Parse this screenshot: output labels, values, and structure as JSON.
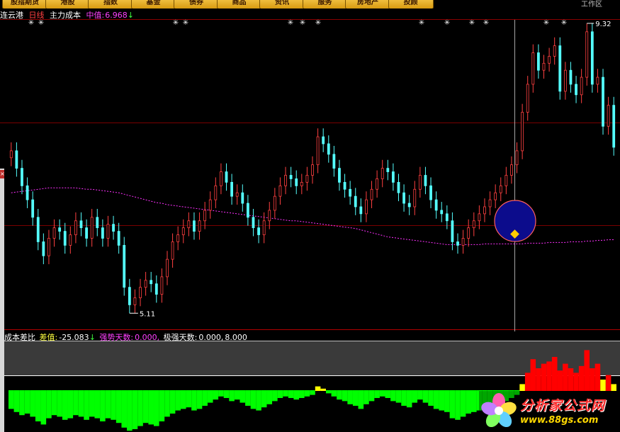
{
  "tabs": [
    "股指期货",
    "港股",
    "指数",
    "基金",
    "债券",
    "商品",
    "资讯",
    "服务",
    "房地产",
    "投顾"
  ],
  "workspace_label": "工作区",
  "main_chart": {
    "stock_name": "连云港",
    "period": "日线",
    "indicator_name": "主力成本",
    "mid_label": "中值:",
    "mid_value": "6.968",
    "mid_arrow": "↓",
    "high_label": "9.32",
    "low_label": "5.11"
  },
  "sub_chart": {
    "name": "成本差比",
    "diff_label": "差值:",
    "diff_value": "-25.083",
    "diff_arrow": "↓",
    "strong_label": "强势天数:",
    "strong_value": "0.000,",
    "very_strong_label": "极强天数:",
    "very_strong_value": "0.000,",
    "extra_value": "8.000"
  },
  "logo": {
    "name": "分析家公式网",
    "url": "www.88gs.com"
  },
  "colors": {
    "up": "#ff4040",
    "down": "#54ffff",
    "cost_line": "#ff30ff",
    "green_bar": "#00ff00",
    "yellow_bar": "#ffff00",
    "red_bar": "#ff0000",
    "header_white": "#ffffff",
    "header_red": "#ff4040",
    "header_magenta": "#ff40ff",
    "header_yellow": "#ffff40",
    "header_cyan": "#40ffff"
  },
  "chart_data": {
    "type": "candlestick",
    "price_range": [
      5.0,
      9.4
    ],
    "close": [
      7.55,
      7.3,
      7.05,
      6.85,
      6.6,
      6.25,
      6.05,
      6.3,
      6.45,
      6.4,
      6.2,
      6.35,
      6.55,
      6.45,
      6.3,
      6.6,
      6.45,
      6.3,
      6.5,
      6.4,
      6.2,
      5.6,
      5.35,
      5.45,
      5.6,
      5.7,
      5.65,
      5.5,
      5.75,
      6.0,
      6.25,
      6.35,
      6.45,
      6.55,
      6.4,
      6.55,
      6.7,
      6.85,
      7.05,
      7.25,
      7.1,
      6.9,
      6.95,
      6.8,
      6.6,
      6.45,
      6.35,
      6.55,
      6.7,
      6.9,
      7.05,
      7.2,
      7.15,
      7.05,
      7.1,
      7.2,
      7.35,
      7.75,
      7.65,
      7.5,
      7.3,
      7.1,
      7.0,
      6.9,
      6.75,
      6.65,
      6.85,
      7.0,
      7.15,
      7.3,
      7.25,
      7.1,
      6.95,
      6.8,
      6.75,
      7.0,
      7.2,
      7.05,
      6.85,
      6.7,
      6.65,
      6.55,
      6.25,
      6.2,
      6.3,
      6.45,
      6.55,
      6.65,
      6.75,
      6.85,
      6.95,
      7.05,
      7.2,
      7.35,
      7.55,
      8.1,
      8.5,
      8.95,
      8.7,
      8.8,
      8.9,
      9.05,
      8.4,
      8.7,
      8.5,
      8.35,
      8.6,
      9.25,
      8.5,
      8.6,
      7.9,
      8.2,
      7.6
    ],
    "cost_line": [
      6.95,
      6.96,
      6.97,
      6.98,
      6.99,
      7.0,
      7.01,
      7.02,
      7.02,
      7.02,
      7.02,
      7.02,
      7.02,
      7.01,
      7.0,
      7.0,
      6.99,
      6.98,
      6.97,
      6.96,
      6.95,
      6.93,
      6.91,
      6.89,
      6.87,
      6.85,
      6.83,
      6.81,
      6.8,
      6.78,
      6.77,
      6.76,
      6.75,
      6.74,
      6.73,
      6.72,
      6.71,
      6.7,
      6.69,
      6.68,
      6.67,
      6.66,
      6.65,
      6.64,
      6.63,
      6.62,
      6.61,
      6.6,
      6.59,
      6.58,
      6.57,
      6.56,
      6.55,
      6.55,
      6.54,
      6.53,
      6.52,
      6.51,
      6.5,
      6.49,
      6.48,
      6.47,
      6.46,
      6.45,
      6.44,
      6.42,
      6.4,
      6.38,
      6.36,
      6.34,
      6.32,
      6.31,
      6.3,
      6.29,
      6.28,
      6.27,
      6.26,
      6.25,
      6.24,
      6.23,
      6.22,
      6.21,
      6.21,
      6.21,
      6.21,
      6.21,
      6.21,
      6.21,
      6.22,
      6.22,
      6.22,
      6.22,
      6.22,
      6.22,
      6.22,
      6.22,
      6.23,
      6.23,
      6.23,
      6.23,
      6.24,
      6.24,
      6.24,
      6.24,
      6.25,
      6.25,
      6.25,
      6.26,
      6.26,
      6.27,
      6.27,
      6.28,
      6.28
    ],
    "sub_values": [
      -12,
      -14,
      -16,
      -15,
      -17,
      -20,
      -22,
      -18,
      -16,
      -17,
      -19,
      -18,
      -16,
      -17,
      -19,
      -17,
      -18,
      -20,
      -18,
      -19,
      -21,
      -24,
      -26,
      -25,
      -23,
      -21,
      -22,
      -23,
      -20,
      -17,
      -15,
      -13,
      -12,
      -11,
      -13,
      -12,
      -10,
      -8,
      -6,
      -4,
      -5,
      -7,
      -6,
      -8,
      -10,
      -12,
      -13,
      -11,
      -9,
      -7,
      -5,
      -4,
      -5,
      -6,
      -5,
      -4,
      -3,
      2,
      1,
      -2,
      -4,
      -6,
      -7,
      -9,
      -10,
      -12,
      -9,
      -7,
      -5,
      -4,
      -5,
      -7,
      -8,
      -10,
      -11,
      -8,
      -6,
      -8,
      -10,
      -12,
      -13,
      -14,
      -18,
      -19,
      -17,
      -15,
      -14,
      -13,
      -12,
      -11,
      -10,
      -9,
      -7,
      -5,
      -3,
      3,
      8,
      14,
      10,
      12,
      13,
      15,
      9,
      12,
      10,
      8,
      11,
      18,
      10,
      12,
      5,
      7,
      3
    ]
  }
}
